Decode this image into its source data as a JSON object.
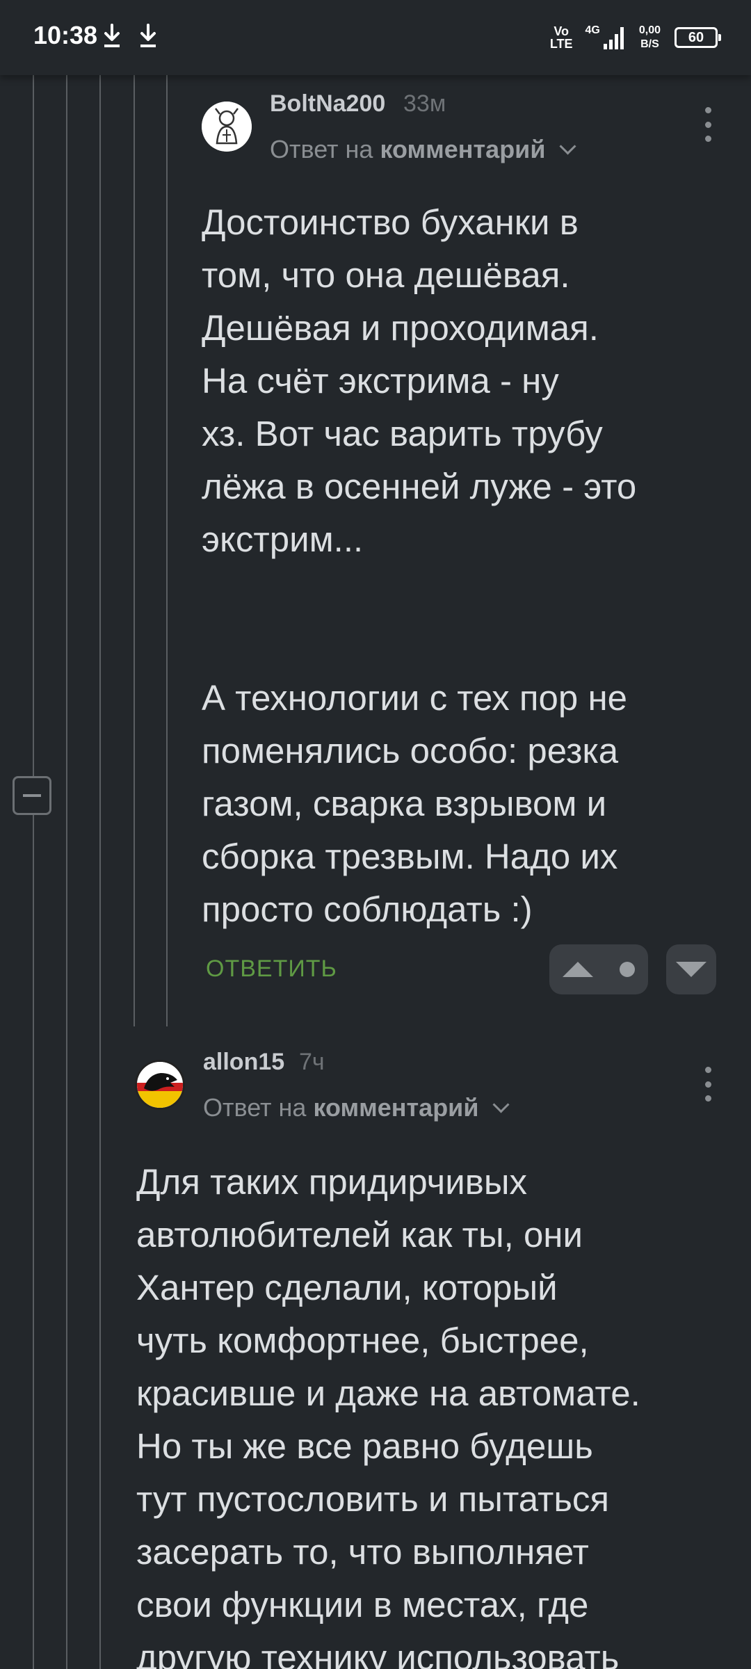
{
  "status_bar": {
    "time": "10:38",
    "volte_top": "Vo",
    "volte_bottom": "LTE",
    "network": "4G",
    "speed_value": "0,00",
    "speed_unit": "B/S",
    "battery": "60",
    "icons": [
      "download-icon",
      "download-icon",
      "signal-icon",
      "battery-icon"
    ]
  },
  "comments": [
    {
      "username": "BoltNa200",
      "time_ago": "33м",
      "reply_prefix": "Ответ на",
      "reply_target": "комментарий",
      "body": "Достоинство буханки в\nтом, что она дешёвая.\nДешёвая и проходимая.\nНа счёт экстрима - ну\nхз. Вот час варить трубу\nлёжа в осенней луже - это\nэкстрим...\n\n\nА технологии с тех пор не\nпоменялись особо: резка\nгазом, сварка взрывом и\nсборка трезвым. Надо их\nпросто соблюдать :)",
      "reply_label": "ОТВЕТИТЬ"
    },
    {
      "username": "allon15",
      "time_ago": "7ч",
      "reply_prefix": "Ответ на",
      "reply_target": "комментарий",
      "body": "Для таких придирчивых\nавтолюбителей как ты, они\nХантер сделали, который\nчуть комфортнее, быстрее,\nкрасивше и даже на автомате.\nНо ты же все равно будешь\nтут пустословить и пытаться\nзасерать то, что выполняет\nсвои функции в местах, где\nдругую технику использовать"
    }
  ],
  "colors": {
    "background": "#23272b",
    "reply_green": "#5f9a44",
    "thread_line": "#5a5e62"
  }
}
